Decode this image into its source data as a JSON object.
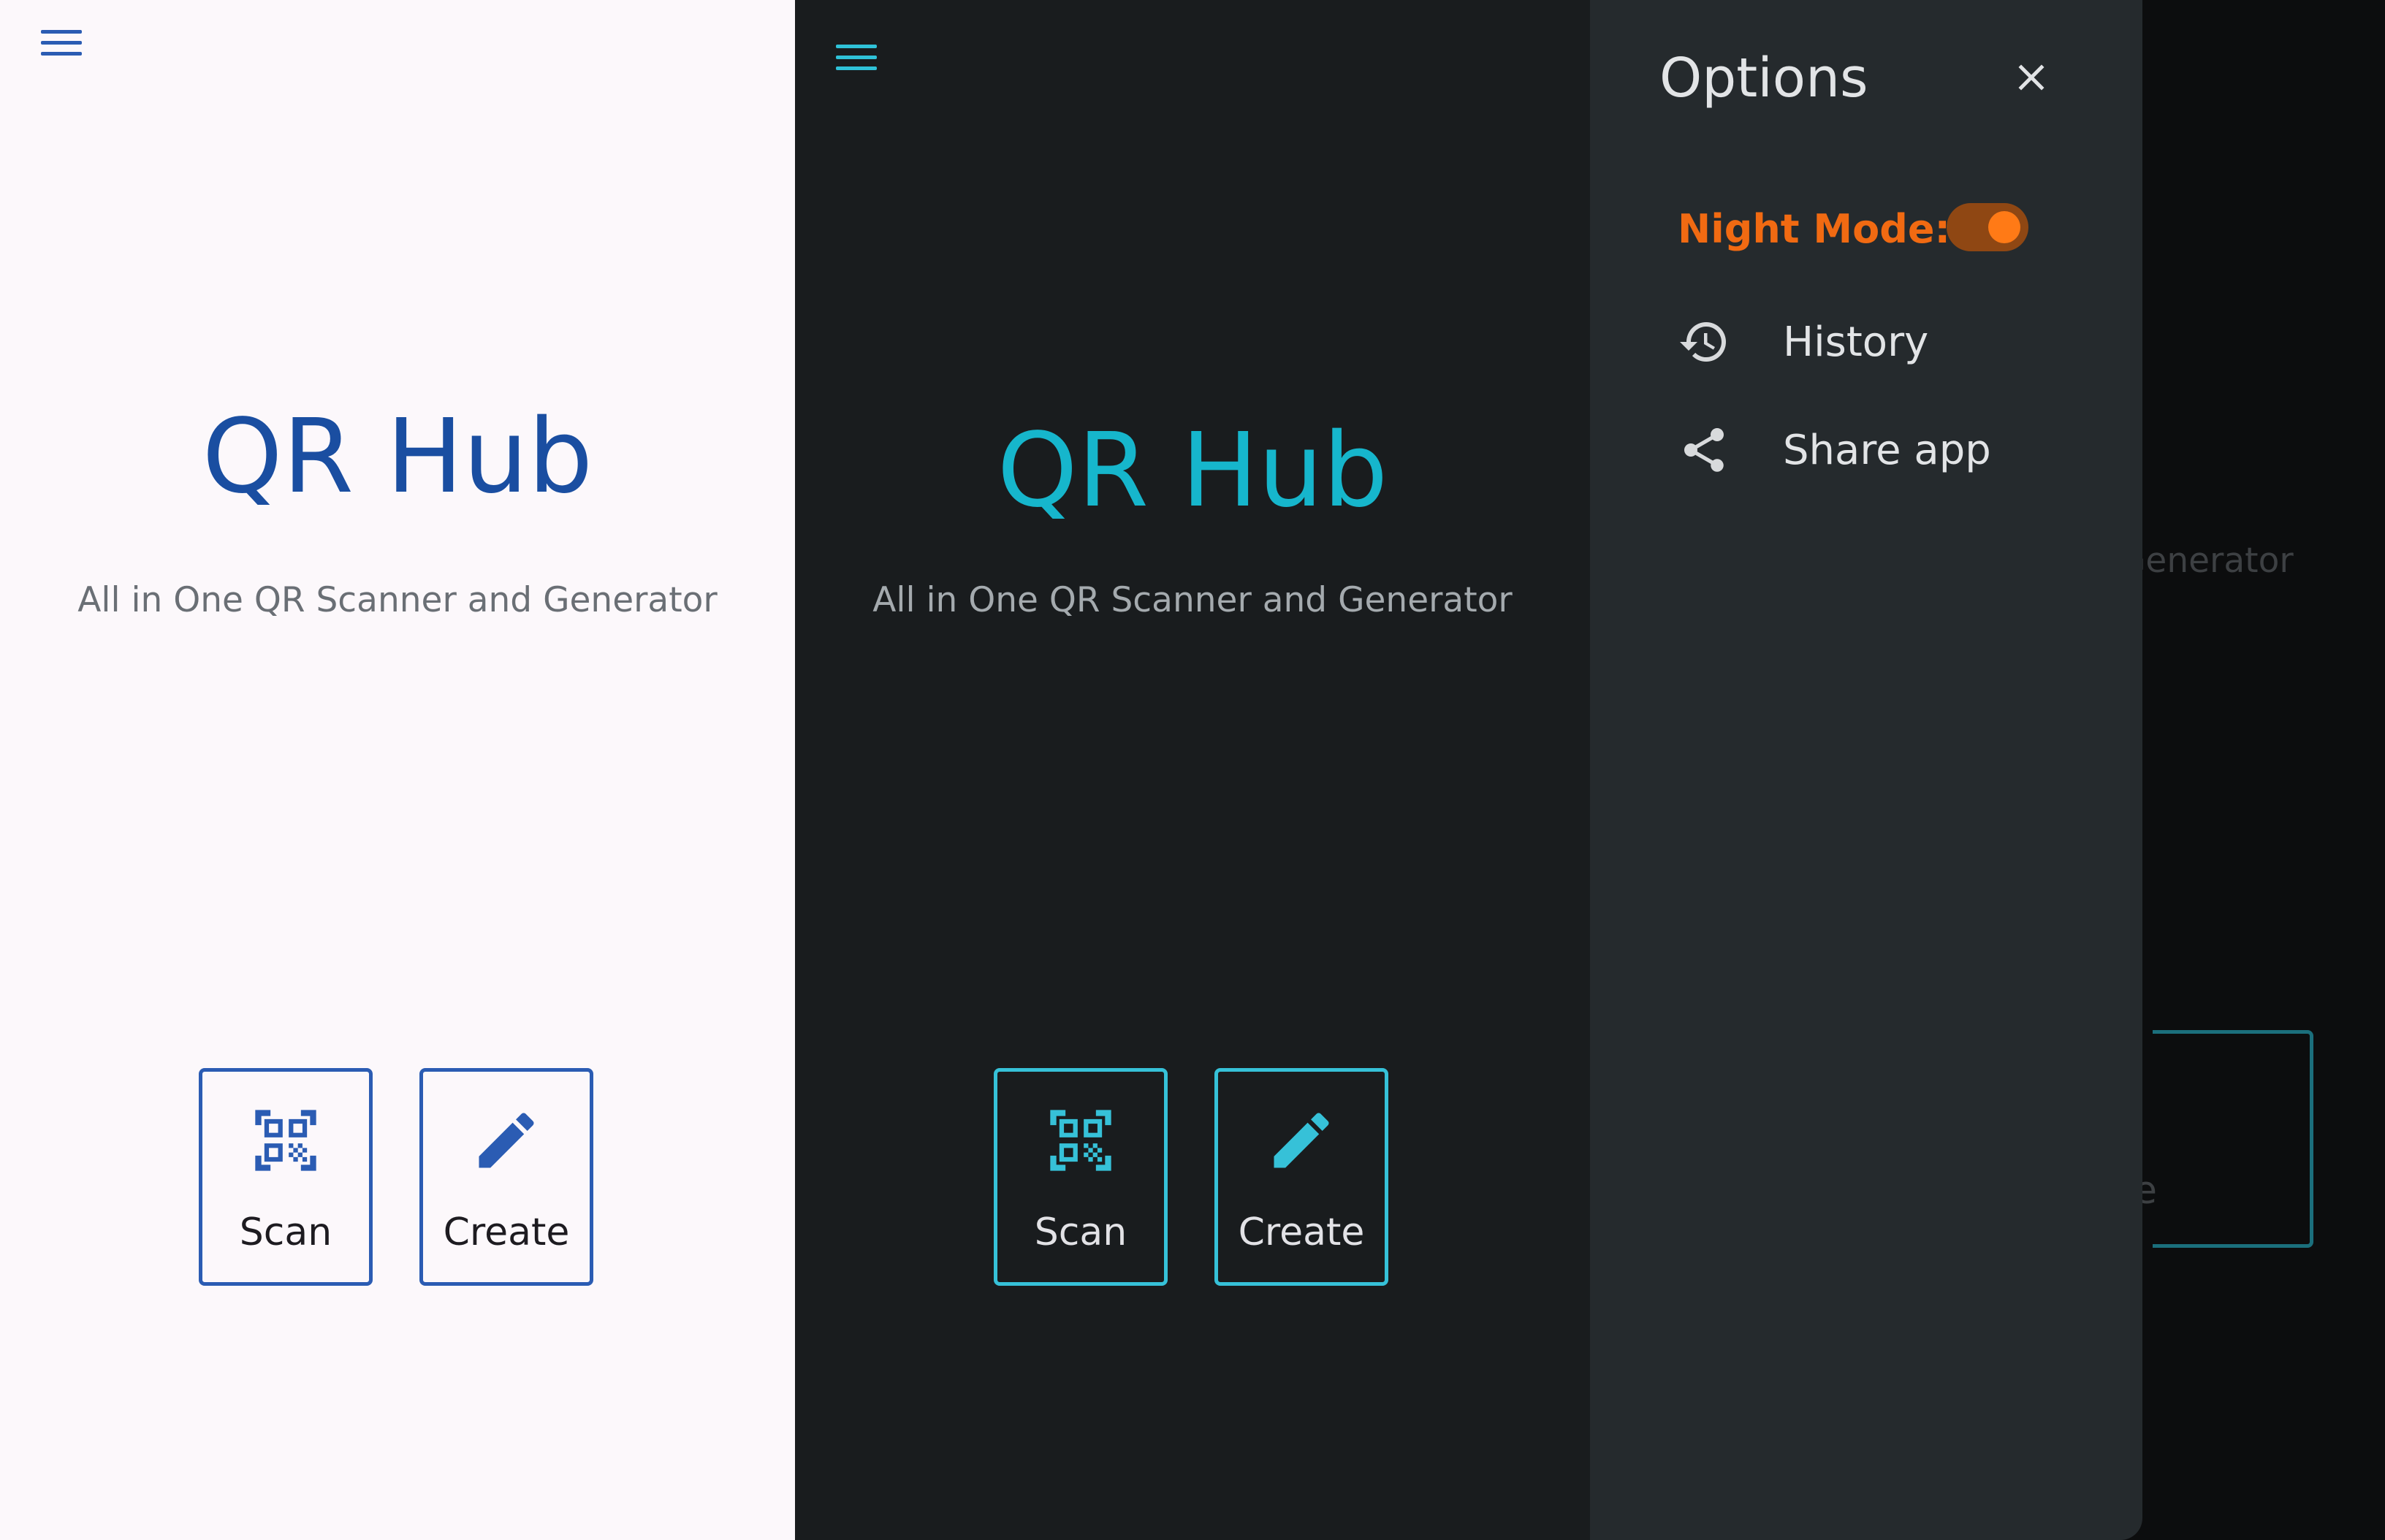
{
  "light": {
    "title": "QR Hub",
    "subtitle": "All in One QR Scanner and Generator",
    "scan_label": "Scan",
    "create_label": "Create",
    "accent": "#1a4ea1",
    "background": "#fcf8fb"
  },
  "dark": {
    "title": "QR Hub",
    "subtitle": "All in One QR Scanner and Generator",
    "scan_label": "Scan",
    "create_label": "Create",
    "accent": "#16b6cc",
    "background": "#191c1e"
  },
  "drawer": {
    "title": "Options",
    "night_mode_label": "Night Mode:",
    "night_mode_enabled": true,
    "night_mode_color": "#f16a12",
    "items": [
      {
        "label": "History",
        "icon": "history-icon"
      },
      {
        "label": "Share app",
        "icon": "share-icon"
      }
    ],
    "behind_subtitle_fragment": "Generator",
    "behind_button_fragment": "e",
    "background": "#252a2d"
  }
}
